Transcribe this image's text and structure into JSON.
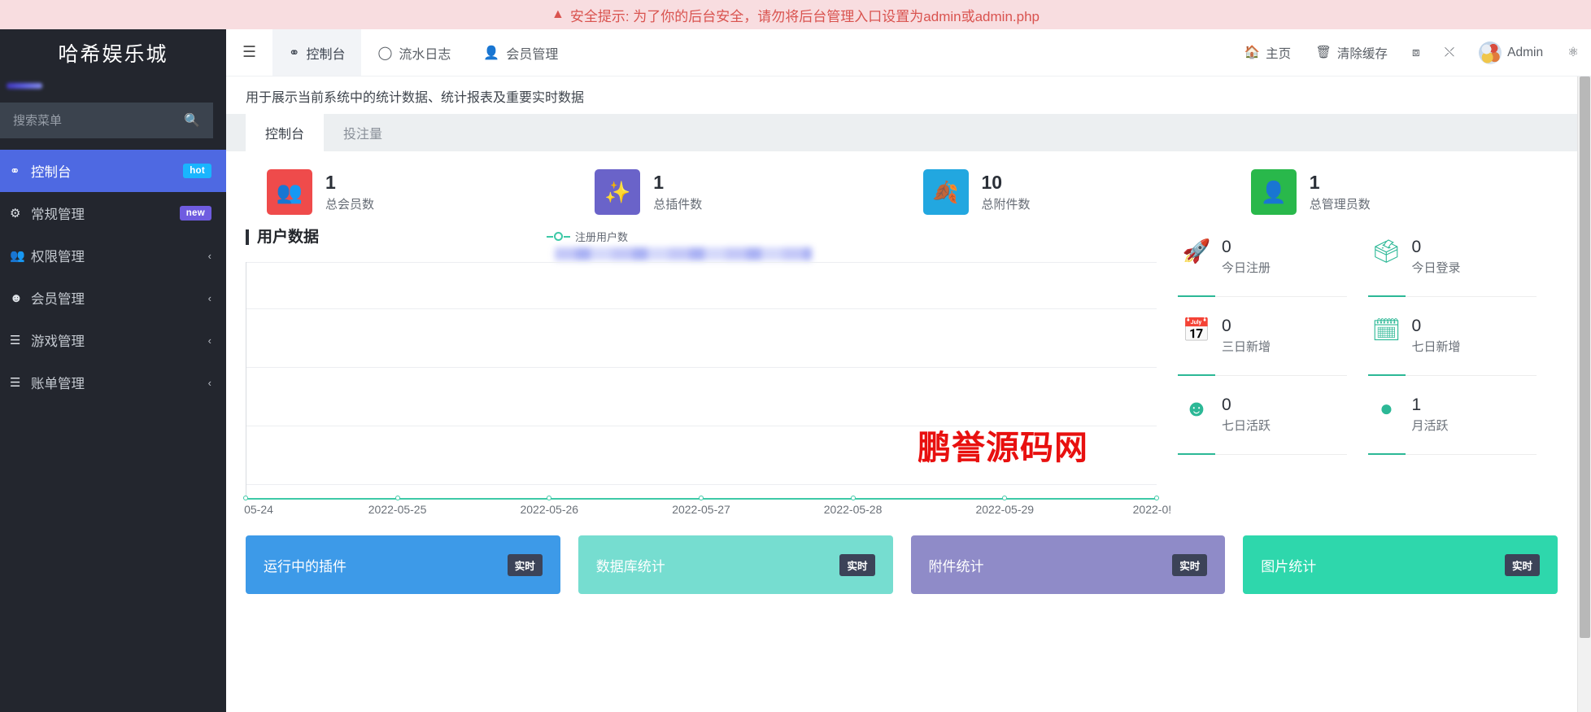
{
  "alert": {
    "icon": "warning-triangle-icon",
    "text": "安全提示: 为了你的后台安全，请勿将后台管理入口设置为admin或admin.php"
  },
  "sidebar": {
    "logo": "哈希娱乐城",
    "search_placeholder": "搜索菜单",
    "search_value": "",
    "items": [
      {
        "label": "控制台",
        "icon": "dashboard-icon",
        "badge": "hot",
        "badge_type": "hot",
        "active": true
      },
      {
        "label": "常规管理",
        "icon": "gears-icon",
        "badge": "new",
        "badge_type": "new",
        "active": false
      },
      {
        "label": "权限管理",
        "icon": "users-group-icon",
        "badge": "",
        "chevron": "‹",
        "active": false
      },
      {
        "label": "会员管理",
        "icon": "user-circle-icon",
        "badge": "",
        "chevron": "‹",
        "active": false
      },
      {
        "label": "游戏管理",
        "icon": "list-icon",
        "badge": "",
        "chevron": "‹",
        "active": false
      },
      {
        "label": "账单管理",
        "icon": "list-icon",
        "badge": "",
        "chevron": "‹",
        "active": false
      }
    ]
  },
  "topbar": {
    "menu_toggle_icon": "hamburger-icon",
    "nav": [
      {
        "label": "控制台",
        "icon": "dashboard-icon",
        "active": true
      },
      {
        "label": "流水日志",
        "icon": "circle-icon",
        "active": false
      },
      {
        "label": "会员管理",
        "icon": "user-icon",
        "active": false
      }
    ],
    "right": [
      {
        "label": "主页",
        "icon": "home-icon"
      },
      {
        "label": "清除缓存",
        "icon": "trash-icon"
      },
      {
        "label": "",
        "icon": "theme-icon"
      },
      {
        "label": "",
        "icon": "fullscreen-icon"
      },
      {
        "label": "Admin",
        "icon": "avatar"
      },
      {
        "label": "",
        "icon": "gear-settings-icon"
      }
    ]
  },
  "page": {
    "description": "用于展示当前系统中的统计数据、统计报表及重要实时数据",
    "tabs": [
      {
        "label": "控制台",
        "active": true
      },
      {
        "label": "投注量",
        "active": false
      }
    ]
  },
  "stats": [
    {
      "value": "1",
      "label": "总会员数",
      "color": "#ef4b4b",
      "icon": "users-icon"
    },
    {
      "value": "1",
      "label": "总插件数",
      "color": "#6a63c9",
      "icon": "magic-wand-icon"
    },
    {
      "value": "10",
      "label": "总附件数",
      "color": "#22a7e0",
      "icon": "leaf-icon"
    },
    {
      "value": "1",
      "label": "总管理员数",
      "color": "#29b84b",
      "icon": "user-solid-icon"
    }
  ],
  "chart_data": {
    "type": "line",
    "title": "用户数据",
    "legend": [
      "注册用户数"
    ],
    "legend_color": "#3ec9a7",
    "legend_position": "top-center",
    "xlabel": "",
    "ylabel": "",
    "grid": true,
    "gridlines": 4,
    "categories": [
      "05-24",
      "2022-05-25",
      "2022-05-26",
      "2022-05-27",
      "2022-05-28",
      "2022-05-29",
      "2022-0!"
    ],
    "series": [
      {
        "name": "注册用户数",
        "values": [
          0,
          0,
          0,
          0,
          0,
          0,
          0
        ]
      }
    ],
    "ylim": [
      0,
      1
    ],
    "note": "数据区被遮挡"
  },
  "watermark": "鹏誉源码网",
  "mini_stats": [
    {
      "value": "0",
      "label": "今日注册",
      "icon": "rocket-icon"
    },
    {
      "value": "0",
      "label": "今日登录",
      "icon": "id-card-icon"
    },
    {
      "value": "0",
      "label": "三日新增",
      "icon": "calendar-icon"
    },
    {
      "value": "0",
      "label": "七日新增",
      "icon": "calendar-plus-icon"
    },
    {
      "value": "0",
      "label": "七日活跃",
      "icon": "user-outline-icon"
    },
    {
      "value": "1",
      "label": "月活跃",
      "icon": "user-filled-icon"
    }
  ],
  "bottom_cards": [
    {
      "title": "运行中的插件",
      "badge": "实时",
      "color": "#3d9ae8"
    },
    {
      "title": "数据库统计",
      "badge": "实时",
      "color": "#76ddd0"
    },
    {
      "title": "附件统计",
      "badge": "实时",
      "color": "#8f8bc8"
    },
    {
      "title": "图片统计",
      "badge": "实时",
      "color": "#2ed7ac"
    }
  ]
}
